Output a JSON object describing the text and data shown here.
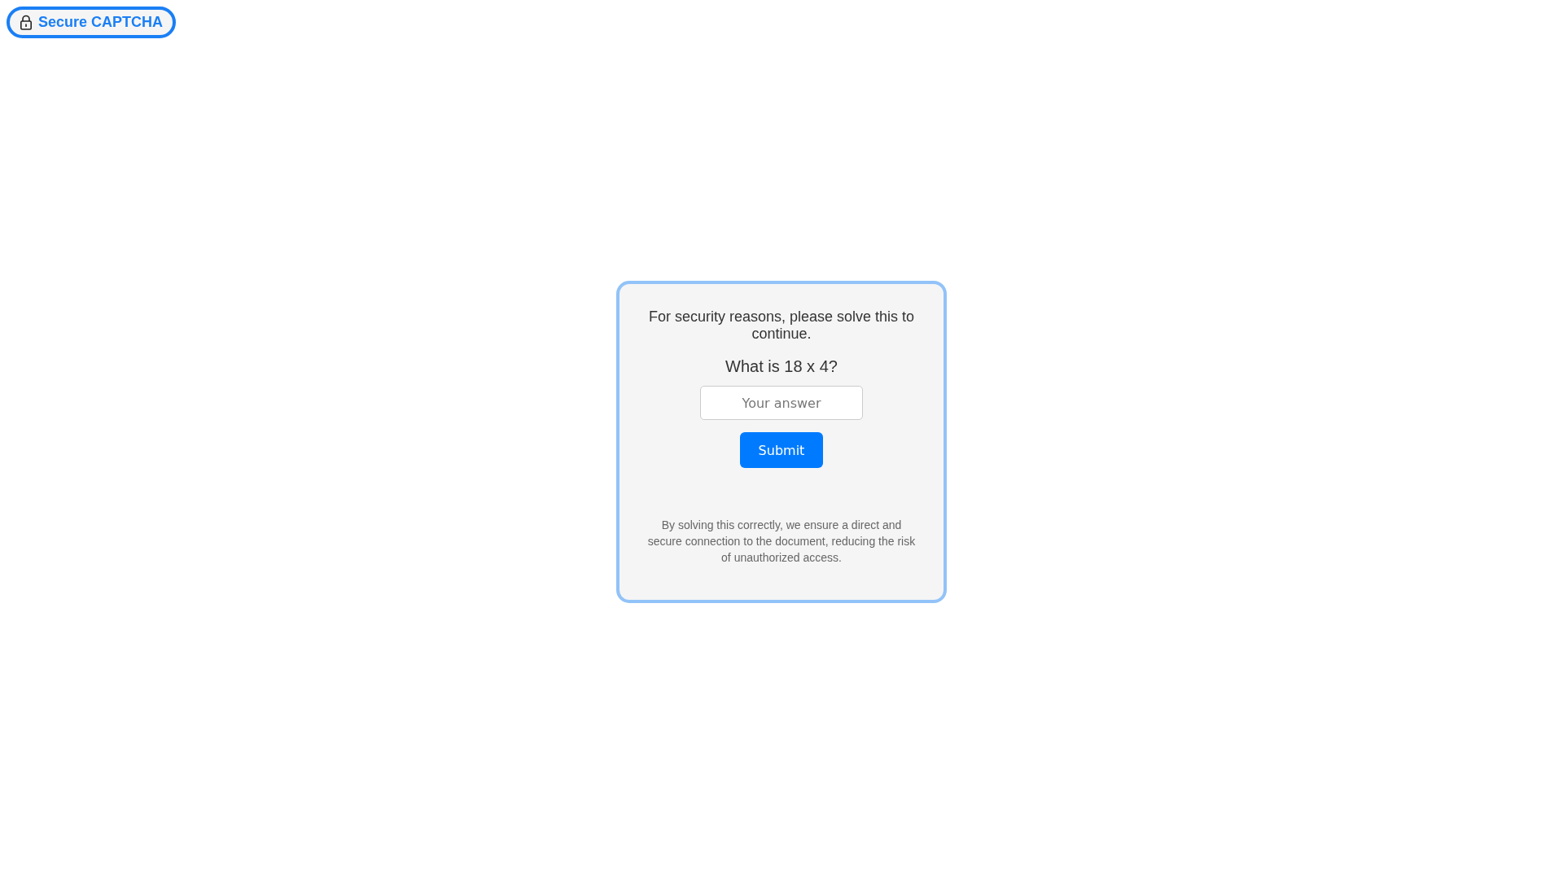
{
  "badge": {
    "label": "Secure CAPTCHA"
  },
  "card": {
    "intro": "For security reasons, please solve this to continue.",
    "question": "What is 18 x 4?",
    "answer": {
      "placeholder": "Your answer"
    },
    "button": "Submit",
    "note": "By solving this correctly, we ensure a direct and secure connection to the document, reducing the risk of unauthorized access."
  }
}
